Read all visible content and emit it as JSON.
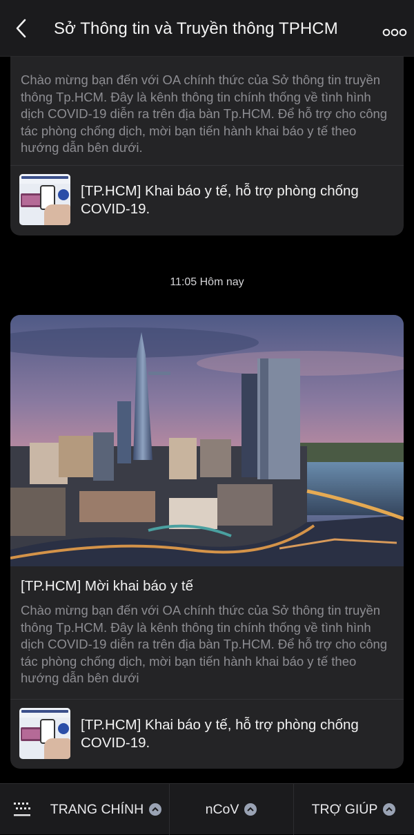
{
  "header": {
    "title": "Sở Thông tin và Truyền thông TPHCM",
    "back_icon": "chevron-left-icon",
    "more_icon": "more-horizontal-icon"
  },
  "messages": [
    {
      "description": "Chào mừng bạn đến với OA chính thức của Sở thông tin truyền thông Tp.HCM. Đây là kênh thông tin chính thống về tình hình dịch COVID-19 diễn ra trên địa bàn Tp.HCM. Để hỗ trợ cho công tác phòng chống dịch, mời bạn tiến hành khai báo y tế theo hướng dẫn bên dưới.",
      "link_text": "[TP.HCM] Khai báo y tế, hỗ trợ phòng chống COVID-19."
    },
    {
      "timestamp": "11:05 Hôm nay",
      "title": "[TP.HCM] Mời khai báo y tế",
      "description": "Chào mừng bạn đến với OA chính thức của Sở thông tin truyền thông Tp.HCM. Đây là kênh thông tin chính thống về tình hình dịch COVID-19 diễn ra trên địa bàn Tp.HCM. Để hỗ trợ cho công tác phòng chống dịch, mời bạn tiến hành khai báo y tế theo hướng dẫn bên dưới",
      "link_text": "[TP.HCM] Khai báo y tế, hỗ trợ phòng chống COVID-19."
    }
  ],
  "bottom_menu": {
    "keyboard_icon": "keyboard-icon",
    "tabs": [
      {
        "label": "TRANG CHÍNH",
        "icon": "chevron-up-circle-icon"
      },
      {
        "label": "nCoV",
        "icon": "chevron-up-circle-icon"
      },
      {
        "label": "TRỢ GIÚP",
        "icon": "chevron-up-circle-icon"
      }
    ]
  },
  "colors": {
    "background": "#000000",
    "bar": "#1b1b1d",
    "card": "#242426",
    "muted_text": "#8d8d92",
    "icon_circle": "#9aa3b4"
  }
}
